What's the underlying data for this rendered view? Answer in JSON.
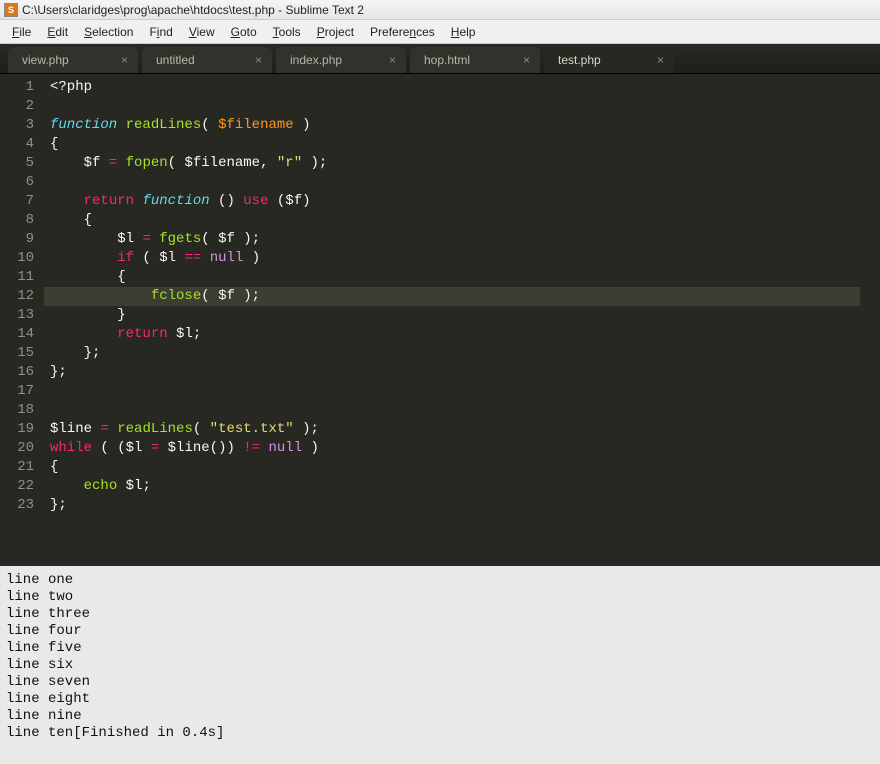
{
  "window": {
    "title": "C:\\Users\\claridges\\prog\\apache\\htdocs\\test.php - Sublime Text 2",
    "icon_letter": "S"
  },
  "menu": {
    "items": [
      {
        "label": "File",
        "u": "F"
      },
      {
        "label": "Edit",
        "u": "E"
      },
      {
        "label": "Selection",
        "u": "S"
      },
      {
        "label": "Find",
        "u": "i"
      },
      {
        "label": "View",
        "u": "V"
      },
      {
        "label": "Goto",
        "u": "G"
      },
      {
        "label": "Tools",
        "u": "T"
      },
      {
        "label": "Project",
        "u": "P"
      },
      {
        "label": "Preferences",
        "u": "n"
      },
      {
        "label": "Help",
        "u": "H"
      }
    ]
  },
  "tabs": [
    {
      "label": "view.php",
      "active": false
    },
    {
      "label": "untitled",
      "active": false
    },
    {
      "label": "index.php",
      "active": false
    },
    {
      "label": "hop.html",
      "active": false
    },
    {
      "label": "test.php",
      "active": true
    }
  ],
  "code": {
    "lines": [
      [
        {
          "t": "<?php",
          "c": "plain"
        }
      ],
      [],
      [
        {
          "t": "function",
          "c": "decl"
        },
        {
          "t": " ",
          "c": "plain"
        },
        {
          "t": "readLines",
          "c": "fn"
        },
        {
          "t": "( ",
          "c": "punct"
        },
        {
          "t": "$filename",
          "c": "var"
        },
        {
          "t": " )",
          "c": "punct"
        }
      ],
      [
        {
          "t": "{",
          "c": "punct"
        }
      ],
      [
        {
          "t": "    ",
          "c": "plain"
        },
        {
          "t": "$f",
          "c": "plain"
        },
        {
          "t": " ",
          "c": "plain"
        },
        {
          "t": "=",
          "c": "op"
        },
        {
          "t": " ",
          "c": "plain"
        },
        {
          "t": "fopen",
          "c": "fn"
        },
        {
          "t": "( ",
          "c": "punct"
        },
        {
          "t": "$filename",
          "c": "plain"
        },
        {
          "t": ", ",
          "c": "punct"
        },
        {
          "t": "\"r\"",
          "c": "str"
        },
        {
          "t": " );",
          "c": "punct"
        }
      ],
      [],
      [
        {
          "t": "    ",
          "c": "plain"
        },
        {
          "t": "return",
          "c": "kw2"
        },
        {
          "t": " ",
          "c": "plain"
        },
        {
          "t": "function",
          "c": "decl"
        },
        {
          "t": " () ",
          "c": "punct"
        },
        {
          "t": "use",
          "c": "kw2"
        },
        {
          "t": " (",
          "c": "punct"
        },
        {
          "t": "$f",
          "c": "plain"
        },
        {
          "t": ")",
          "c": "punct"
        }
      ],
      [
        {
          "t": "    {",
          "c": "punct"
        }
      ],
      [
        {
          "t": "        ",
          "c": "plain"
        },
        {
          "t": "$l",
          "c": "plain"
        },
        {
          "t": " ",
          "c": "plain"
        },
        {
          "t": "=",
          "c": "op"
        },
        {
          "t": " ",
          "c": "plain"
        },
        {
          "t": "fgets",
          "c": "fn"
        },
        {
          "t": "( ",
          "c": "punct"
        },
        {
          "t": "$f",
          "c": "plain"
        },
        {
          "t": " );",
          "c": "punct"
        }
      ],
      [
        {
          "t": "        ",
          "c": "plain"
        },
        {
          "t": "if",
          "c": "kw2"
        },
        {
          "t": " ( ",
          "c": "punct"
        },
        {
          "t": "$l",
          "c": "plain"
        },
        {
          "t": " ",
          "c": "plain"
        },
        {
          "t": "==",
          "c": "op"
        },
        {
          "t": " ",
          "c": "plain"
        },
        {
          "t": "null",
          "c": "const"
        },
        {
          "t": " )",
          "c": "punct"
        }
      ],
      [
        {
          "t": "        {",
          "c": "punct"
        }
      ],
      [
        {
          "t": "            ",
          "c": "plain"
        },
        {
          "t": "fclose",
          "c": "fn"
        },
        {
          "t": "( ",
          "c": "punct"
        },
        {
          "t": "$f",
          "c": "plain"
        },
        {
          "t": " );",
          "c": "punct"
        }
      ],
      [
        {
          "t": "        }",
          "c": "punct"
        }
      ],
      [
        {
          "t": "        ",
          "c": "plain"
        },
        {
          "t": "return",
          "c": "kw2"
        },
        {
          "t": " ",
          "c": "plain"
        },
        {
          "t": "$l",
          "c": "plain"
        },
        {
          "t": ";",
          "c": "punct"
        }
      ],
      [
        {
          "t": "    };",
          "c": "punct"
        }
      ],
      [
        {
          "t": "};",
          "c": "punct"
        }
      ],
      [],
      [],
      [
        {
          "t": "$line",
          "c": "plain"
        },
        {
          "t": " ",
          "c": "plain"
        },
        {
          "t": "=",
          "c": "op"
        },
        {
          "t": " ",
          "c": "plain"
        },
        {
          "t": "readLines",
          "c": "fn"
        },
        {
          "t": "( ",
          "c": "punct"
        },
        {
          "t": "\"test.txt\"",
          "c": "str"
        },
        {
          "t": " );",
          "c": "punct"
        }
      ],
      [
        {
          "t": "while",
          "c": "kw2"
        },
        {
          "t": " ( (",
          "c": "punct"
        },
        {
          "t": "$l",
          "c": "plain"
        },
        {
          "t": " ",
          "c": "plain"
        },
        {
          "t": "=",
          "c": "op"
        },
        {
          "t": " ",
          "c": "plain"
        },
        {
          "t": "$line",
          "c": "plain"
        },
        {
          "t": "()) ",
          "c": "punct"
        },
        {
          "t": "!=",
          "c": "op"
        },
        {
          "t": " ",
          "c": "plain"
        },
        {
          "t": "null",
          "c": "const"
        },
        {
          "t": " )",
          "c": "punct"
        }
      ],
      [
        {
          "t": "{",
          "c": "punct"
        }
      ],
      [
        {
          "t": "    ",
          "c": "plain"
        },
        {
          "t": "echo",
          "c": "fn"
        },
        {
          "t": " ",
          "c": "plain"
        },
        {
          "t": "$l",
          "c": "plain"
        },
        {
          "t": ";",
          "c": "punct"
        }
      ],
      [
        {
          "t": "};",
          "c": "punct"
        }
      ]
    ],
    "highlighted_line": 12
  },
  "output": {
    "lines": [
      "line one",
      "line two",
      "line three",
      "line four",
      "line five",
      "line six",
      "line seven",
      "line eight",
      "line nine",
      "line ten[Finished in 0.4s]"
    ]
  }
}
